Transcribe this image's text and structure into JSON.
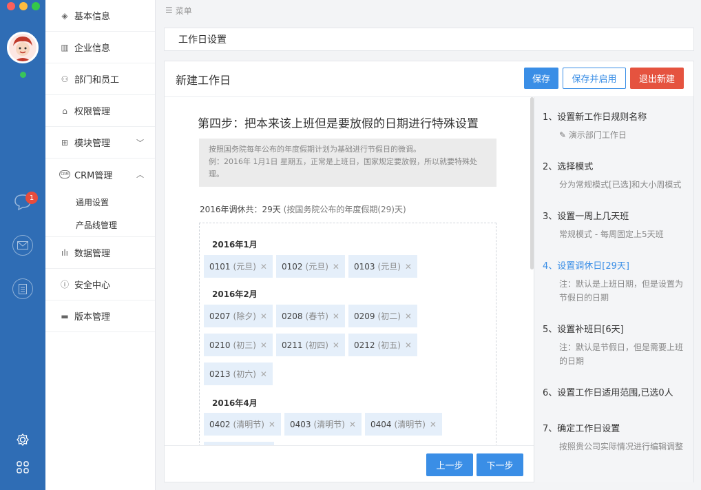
{
  "rail": {
    "badge_count": "1",
    "traffic_colors": [
      "#fc605c",
      "#fdbc40",
      "#34c84a"
    ],
    "accent": "#2f6db5"
  },
  "nav": {
    "items": [
      {
        "icon": "layers-icon",
        "label": "基本信息"
      },
      {
        "icon": "building-icon",
        "label": "企业信息"
      },
      {
        "icon": "users-icon",
        "label": "部门和员工"
      },
      {
        "icon": "lock-icon",
        "label": "权限管理"
      },
      {
        "icon": "modules-icon",
        "label": "模块管理"
      },
      {
        "icon": "crm-icon",
        "label": "CRM管理",
        "crm_mark": "CRM"
      }
    ],
    "sub_items": [
      "通用设置",
      "产品线管理"
    ],
    "items_after": [
      {
        "icon": "bar-chart-icon",
        "label": "数据管理"
      },
      {
        "icon": "alert-circle-icon",
        "label": "安全中心"
      },
      {
        "icon": "version-icon",
        "label": "版本管理"
      }
    ]
  },
  "main": {
    "menu_label": "菜单",
    "page_title": "工作日设置",
    "panel_title": "新建工作日",
    "buttons": {
      "save": "保存",
      "save_enable": "保存并启用",
      "exit": "退出新建",
      "prev": "上一步",
      "next": "下一步"
    },
    "step_heading": "第四步：把本来该上班但是要放假的日期进行特殊设置",
    "notice_line1": "按照国务院每年公布的年度假期计划为基础进行节假日的微调。",
    "notice_line2": "例：2016年 1月1日 星期五，正常是上班日，国家规定要放假，所以就要特殊处理。",
    "summary_main": "2016年调休共：29天",
    "summary_muted": "(按国务院公布的年度假期(29)天)",
    "months": [
      {
        "label": "2016年1月",
        "tags": [
          {
            "date": "0101",
            "holiday": "(元旦)"
          },
          {
            "date": "0102",
            "holiday": "(元旦)"
          },
          {
            "date": "0103",
            "holiday": "(元旦)"
          }
        ]
      },
      {
        "label": "2016年2月",
        "tags": [
          {
            "date": "0207",
            "holiday": "(除夕)"
          },
          {
            "date": "0208",
            "holiday": "(春节)"
          },
          {
            "date": "0209",
            "holiday": "(初二)"
          },
          {
            "date": "0210",
            "holiday": "(初三)"
          },
          {
            "date": "0211",
            "holiday": "(初四)"
          },
          {
            "date": "0212",
            "holiday": "(初五)"
          },
          {
            "date": "0213",
            "holiday": "(初六)"
          }
        ]
      },
      {
        "label": "2016年4月",
        "tags": [
          {
            "date": "0402",
            "holiday": "(清明节)"
          },
          {
            "date": "0403",
            "holiday": "(清明节)"
          },
          {
            "date": "0404",
            "holiday": "(清明节)"
          }
        ]
      }
    ]
  },
  "steps": [
    {
      "title": "1、设置新工作日规则名称",
      "desc": "演示部门工作日",
      "desc_icon": "pencil-icon"
    },
    {
      "title": "2、选择模式",
      "desc": "分为常规模式[已选]和大小周模式"
    },
    {
      "title": "3、设置一周上几天班",
      "desc": "常规模式 - 每周固定上5天班"
    },
    {
      "title": "4、设置调休日[29天]",
      "desc": "注：默认是上班日期，但是设置为节假日的日期",
      "active": true
    },
    {
      "title": "5、设置补班日[6天]",
      "desc": "注：默认是节假日，但是需要上班的日期"
    },
    {
      "title": "6、设置工作日适用范围,已选0人",
      "desc": ""
    },
    {
      "title": "7、确定工作日设置",
      "desc": "按照贵公司实际情况进行编辑调整"
    }
  ]
}
